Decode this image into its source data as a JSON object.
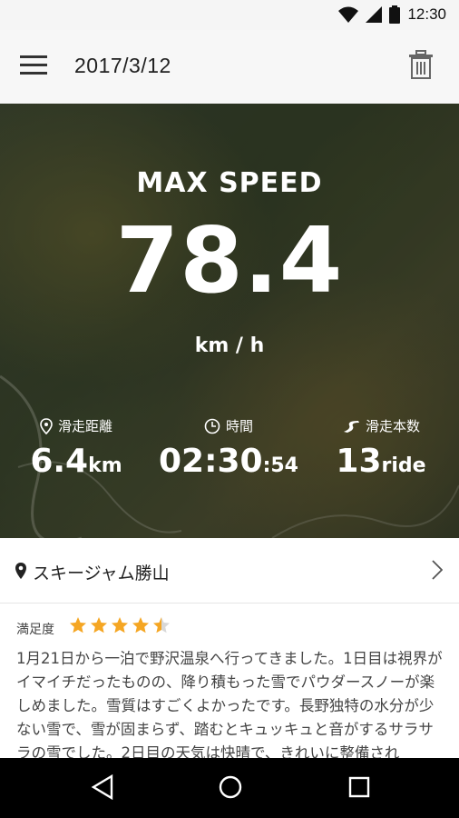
{
  "status_bar": {
    "time": "12:30",
    "icons": [
      "wifi-icon",
      "signal-icon",
      "battery-icon"
    ]
  },
  "app_bar": {
    "title": "2017/3/12",
    "menu_icon": "menu-icon",
    "delete_icon": "trash-icon"
  },
  "hero": {
    "label": "MAX SPEED",
    "value": "78.4",
    "unit": "km / h",
    "stats": [
      {
        "icon": "location-pin-icon",
        "label": "滑走距離",
        "value": "6.4",
        "unit": "km"
      },
      {
        "icon": "clock-icon",
        "label": "時間",
        "value": "02:30",
        "unit": ":54"
      },
      {
        "icon": "ski-run-icon",
        "label": "滑走本数",
        "value": "13",
        "unit": "ride"
      }
    ]
  },
  "location": {
    "name": "スキージャム勝山",
    "icon": "location-pin-icon",
    "chevron": "chevron-right-icon"
  },
  "review": {
    "label": "満足度",
    "rating": 4.5,
    "max_rating": 5,
    "text": "1月21日から一泊で野沢温泉へ行ってきました。1日目は視界がイマイチだったものの、降り積もった雪でパウダースノーが楽しめました。雪質はすごくよかったです。長野独特の水分が少ない雪で、雪が固まらず、踏むとキュッキュと音がするサラサラの雪でした。2日目の天気は快晴で、きれいに整備され"
  },
  "nav_bar": {
    "buttons": [
      "back-icon",
      "home-icon",
      "recents-icon"
    ]
  },
  "colors": {
    "star": "#f5a623",
    "text": "#444444",
    "hero_text": "#ffffff"
  }
}
